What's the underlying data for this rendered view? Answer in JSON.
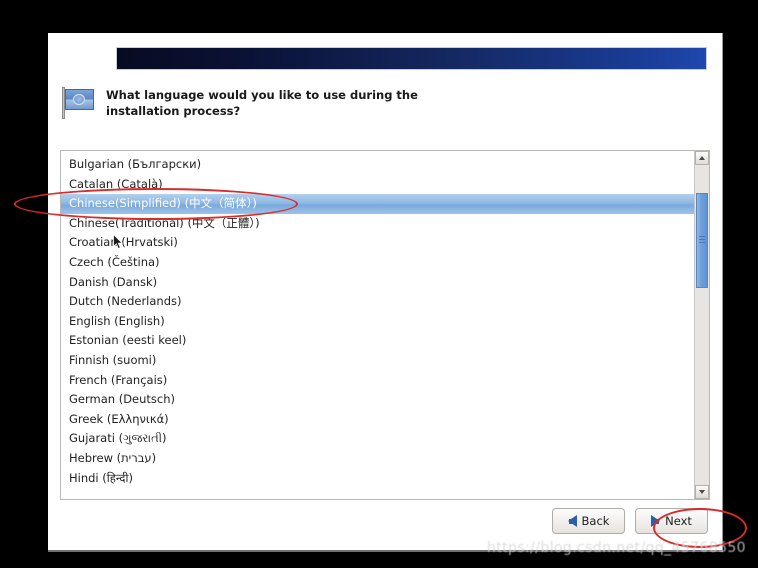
{
  "dialog": {
    "prompt": "What language would you like to use during the installation process?",
    "flag_icon": "flag-icon"
  },
  "language_list": {
    "selected_index": 2,
    "items": [
      "Bulgarian (Български)",
      "Catalan (Català)",
      "Chinese(Simplified) (中文（简体）)",
      "Chinese(Traditional) (中文（正體）)",
      "Croatian (Hrvatski)",
      "Czech (Čeština)",
      "Danish (Dansk)",
      "Dutch (Nederlands)",
      "English (English)",
      "Estonian (eesti keel)",
      "Finnish (suomi)",
      "French (Français)",
      "German (Deutsch)",
      "Greek (Ελληνικά)",
      "Gujarati (ગુજરાતી)",
      "Hebrew (עברית)",
      "Hindi (हिन्दी)"
    ]
  },
  "scrollbar": {
    "up_arrow_icon": "chevron-up-icon",
    "down_arrow_icon": "chevron-down-icon"
  },
  "footer": {
    "back_label": "Back",
    "next_label": "Next",
    "back_icon": "arrow-left-icon",
    "next_icon": "arrow-right-icon"
  },
  "watermark": {
    "text": "https://blog.csdn.net/qq_45768550"
  },
  "colors": {
    "banner_dark": "#070b22",
    "banner_light": "#1f47ad",
    "selection_blue": "#7aa9dd",
    "annotation_red": "#d92b2b",
    "arrow_blue": "#2d5fa8"
  }
}
